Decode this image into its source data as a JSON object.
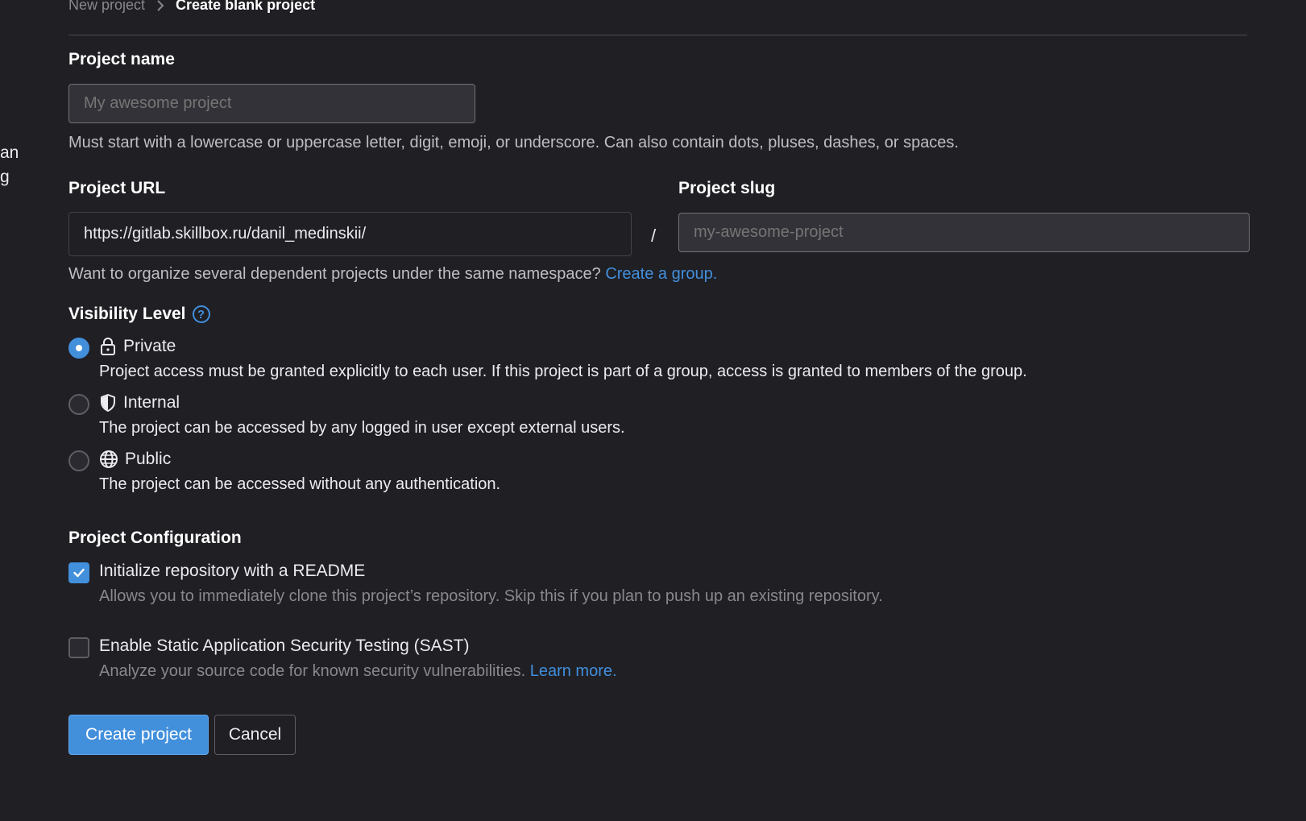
{
  "left_sidebar_fragments": [
    "an",
    "g"
  ],
  "breadcrumb": {
    "parent": "New project",
    "current": "Create blank project"
  },
  "project_name": {
    "label": "Project name",
    "placeholder": "My awesome project",
    "value": "",
    "help": "Must start with a lowercase or uppercase letter, digit, emoji, or underscore. Can also contain dots, pluses, dashes, or spaces."
  },
  "project_url": {
    "label": "Project URL",
    "value": "https://gitlab.skillbox.ru/danil_medinskii/",
    "separator": "/"
  },
  "project_slug": {
    "label": "Project slug",
    "placeholder": "my-awesome-project",
    "value": ""
  },
  "namespace_help": {
    "text": "Want to organize several dependent projects under the same namespace? ",
    "link": "Create a group."
  },
  "visibility": {
    "label": "Visibility Level",
    "help_icon": "question-circle-icon",
    "selected": "private",
    "options": [
      {
        "id": "private",
        "icon": "lock-icon",
        "title": "Private",
        "description": "Project access must be granted explicitly to each user. If this project is part of a group, access is granted to members of the group."
      },
      {
        "id": "internal",
        "icon": "shield-icon",
        "title": "Internal",
        "description": "The project can be accessed by any logged in user except external users."
      },
      {
        "id": "public",
        "icon": "globe-icon",
        "title": "Public",
        "description": "The project can be accessed without any authentication."
      }
    ]
  },
  "configuration": {
    "label": "Project Configuration",
    "readme": {
      "checked": true,
      "title": "Initialize repository with a README",
      "description": "Allows you to immediately clone this project’s repository. Skip this if you plan to push up an existing repository."
    },
    "sast": {
      "checked": false,
      "title": "Enable Static Application Security Testing (SAST)",
      "description": "Analyze your source code for known security vulnerabilities. ",
      "link": "Learn more."
    }
  },
  "buttons": {
    "create": "Create project",
    "cancel": "Cancel"
  },
  "colors": {
    "background": "#1f1f24",
    "accent": "#428fdc",
    "text": "#ececef",
    "muted": "#89888d"
  }
}
